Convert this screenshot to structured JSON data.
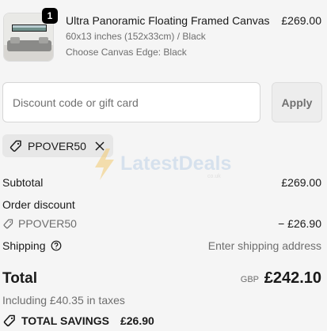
{
  "product": {
    "quantity": "1",
    "title": "Ultra Panoramic Floating Framed Canvas",
    "price": "£269.00",
    "variant": "60x13 inches (152x33cm) / Black",
    "option": "Choose Canvas Edge: Black"
  },
  "discount": {
    "placeholder": "Discount code or gift card",
    "apply_label": "Apply",
    "applied_code": "PPOVER50"
  },
  "watermark": {
    "text": "LatestDeals",
    "sub": "co.uk"
  },
  "summary": {
    "subtotal_label": "Subtotal",
    "subtotal_value": "£269.00",
    "order_discount_label": "Order discount",
    "discount_code": "PPOVER50",
    "discount_value": "− £26.90",
    "shipping_label": "Shipping",
    "shipping_value": "Enter shipping address",
    "total_label": "Total",
    "currency": "GBP",
    "total_value": "£242.10",
    "taxes_note": "Including £40.35 in taxes",
    "savings_label": "TOTAL SAVINGS",
    "savings_value": "£26.90"
  }
}
